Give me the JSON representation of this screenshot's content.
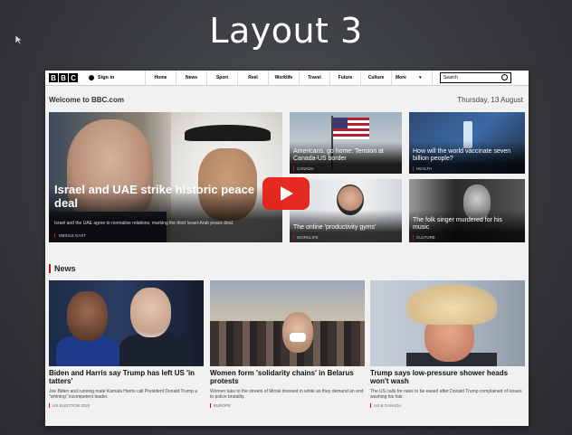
{
  "slide": {
    "title": "Layout 3"
  },
  "nav": {
    "logo": [
      "B",
      "B",
      "C"
    ],
    "signin": "Sign in",
    "items": [
      "Home",
      "News",
      "Sport",
      "Reel",
      "Worklife",
      "Travel",
      "Future",
      "Culture"
    ],
    "more": "More",
    "search_placeholder": "Search"
  },
  "header": {
    "welcome": "Welcome to BBC.com",
    "date": "Thursday, 13 August"
  },
  "top_stories": [
    {
      "title": "Israel and UAE strike historic peace deal",
      "summary": "Israel and the UAE agree to normalise relations, marking the third Israel-Arab peace deal.",
      "tag": "MIDDLE EAST"
    },
    {
      "title": "Americans, go home: Tension at Canada-US border",
      "tag": "CANADA"
    },
    {
      "title": "How will the world vaccinate seven billion people?",
      "tag": "HEALTH"
    },
    {
      "title": "The online 'productivity gyms'",
      "tag": "WORKLIFE"
    },
    {
      "title": "The folk singer murdered for his music",
      "tag": "CULTURE"
    }
  ],
  "news": {
    "heading": "News",
    "cards": [
      {
        "title": "Biden and Harris say Trump has left US 'in tatters'",
        "summary": "Joe Biden and running mate Kamala Harris call President Donald Trump a \"whining\" incompetent leader.",
        "tag": "US ELECTION 2020"
      },
      {
        "title": "Women form 'solidarity chains' in Belarus protests",
        "summary": "Women take to the streets of Minsk dressed in white as they demand an end to police brutality.",
        "tag": "EUROPE"
      },
      {
        "title": "Trump says low-pressure shower heads won't wash",
        "summary": "The US calls for rules to be eased after Donald Trump complained of issues washing his hair.",
        "tag": "US & CANADA"
      }
    ]
  },
  "colors": {
    "bbc_red": "#bb1919",
    "play_red": "#e62117"
  }
}
